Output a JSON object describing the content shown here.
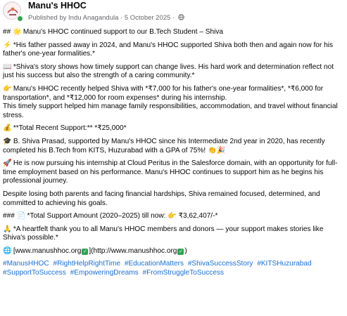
{
  "header": {
    "page_name": "Manu's HHOC",
    "published_by_prefix": "Published by ",
    "author": "Indu Anagandula",
    "separator": " · ",
    "date": "5 October 2025",
    "date_separator": " · ",
    "avatar_icon": "hhoc-logo-icon",
    "privacy_icon": "globe-icon",
    "online_color": "#31a24c"
  },
  "post": {
    "title_prefix": "## ",
    "title_icon": "🌟",
    "title": "Manu's HHOC continued support to our B.Tech Student – Shiva",
    "p1_icon": "⚡",
    "p1": "*His father passed away in 2024, and Manu's HHOC supported Shiva both then and again now for his father's one-year formalities.*",
    "p2_icon": "📖",
    "p2": "*Shiva's story shows how timely support can change lives. His hard work and determination reflect not just his success but also the strength of a caring community.*",
    "p3_icon": "👉",
    "p3": "Manu's HHOC recently helped Shiva with *₹7,000 for his father's one-year formalities*, *₹6,000 for transportation*, and *₹12,000 for room expenses* during his internship.",
    "p3b": "This timely support helped him manage family responsibilities, accommodation, and travel without financial stress.",
    "p4_icon": "💰",
    "p4": "**Total Recent Support:** *₹25,000*",
    "p5_icon": "🎓",
    "p5": "B. Shiva Prasad, supported by Manu's HHOC since his Intermediate 2nd year in 2020, has recently completed his B.Tech from KITS, Huzurabad with a GPA of 75%! 👏🎉",
    "p6_icon": "🚀",
    "p6": "He is now pursuing his internship at Cloud Peritus in the Salesforce domain, with an opportunity for full-time employment based on his performance. Manu's HHOC continues to support him as he begins his professional journey.",
    "p7": "Despite losing both parents and facing financial hardships, Shiva remained focused, determined, and committed to achieving his goals.",
    "p8_prefix": "### ",
    "p8_icon": "📄",
    "p8": "*Total Support Amount (2020–2025) till now: 👉 ₹3,62,407/-*",
    "p9_icon": "🙏",
    "p9": "*A heartfelt thank you to all Manu's HHOC members and donors — your support makes stories like Shiva's possible.*",
    "link_icon": "🌐",
    "link_part1": "[www.manushhoc.org",
    "link_part2": "](http://www.manushhoc.org",
    "link_part3": ")",
    "hashtags": [
      "#ManusHHOC",
      "#RightHelpRightTime",
      "#EducationMatters",
      "#ShivaSuccessStory",
      "#KITSHuzurabad",
      "#SupportToSuccess",
      "#EmpoweringDreams",
      "#FromStruggleToSuccess"
    ],
    "hashtag_color": "#1b6fd6"
  }
}
